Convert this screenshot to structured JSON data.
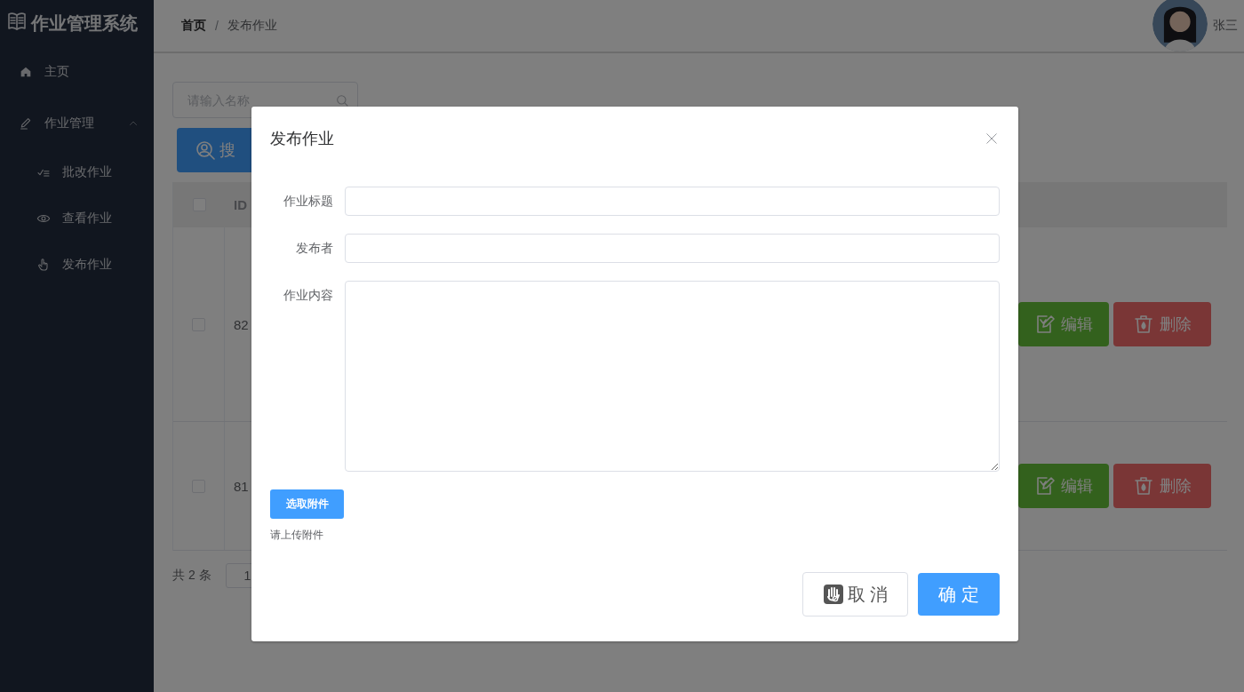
{
  "sidebar": {
    "logo": "作业管理系统",
    "items": [
      {
        "label": "主页"
      },
      {
        "label": "作业管理",
        "expanded": true,
        "children": [
          {
            "label": "批改作业"
          },
          {
            "label": "查看作业"
          },
          {
            "label": "发布作业"
          }
        ]
      }
    ]
  },
  "header": {
    "breadcrumb": [
      "首页",
      "发布作业"
    ],
    "separator": "/",
    "user_name": "张三"
  },
  "toolbar": {
    "search": {
      "placeholder": "请输入名称"
    },
    "search_button": "搜"
  },
  "table": {
    "select_all": {
      "checked": false
    },
    "columns": [
      {
        "label": "ID"
      }
    ],
    "rows": [
      {
        "checked": false,
        "id": "82",
        "actions": [
          {
            "kind": "edit",
            "label": "编辑"
          },
          {
            "kind": "delete",
            "label": "删除"
          }
        ]
      },
      {
        "checked": false,
        "id": "81",
        "actions": [
          {
            "kind": "edit",
            "label": "编辑"
          },
          {
            "kind": "delete",
            "label": "删除"
          }
        ]
      }
    ]
  },
  "pagination": {
    "total": "共 2 条",
    "page_size": "1"
  },
  "dialog": {
    "title": "发布作业",
    "fields": [
      {
        "kind": "input",
        "label": "作业标题"
      },
      {
        "kind": "input",
        "label": "发布者"
      },
      {
        "kind": "textarea",
        "label": "作业内容"
      }
    ],
    "upload_button": "选取附件",
    "upload_tip": "请上传附件",
    "buttons": [
      {
        "kind": "cancel",
        "label": "取 消"
      },
      {
        "kind": "confirm",
        "label": "确 定"
      }
    ]
  }
}
